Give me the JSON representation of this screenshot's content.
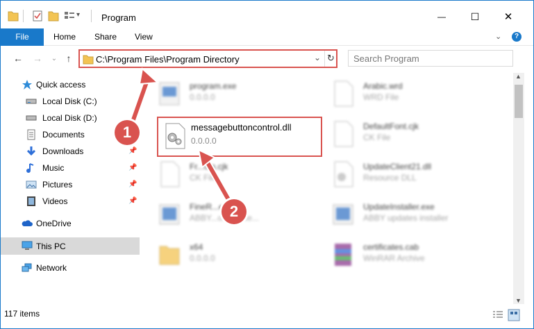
{
  "window": {
    "title": "Program",
    "minimize": "—",
    "maximize": "☐",
    "close": "✕"
  },
  "ribbon": {
    "tabs": [
      "File",
      "Home",
      "Share",
      "View"
    ],
    "expand_icon": "chevron-down",
    "help_icon": "help"
  },
  "address": {
    "path": "C:\\Program Files\\Program Directory",
    "refresh_icon": "refresh",
    "dropdown_icon": "chevron-down"
  },
  "search": {
    "placeholder": "Search Program"
  },
  "sidebar": {
    "items": [
      {
        "label": "Quick access",
        "icon": "star-icon",
        "pinned": false
      },
      {
        "label": "Local Disk (C:)",
        "icon": "drive-icon",
        "pinned": false
      },
      {
        "label": "Local Disk (D:)",
        "icon": "drive-icon",
        "pinned": false
      },
      {
        "label": "Documents",
        "icon": "documents-icon",
        "pinned": true
      },
      {
        "label": "Downloads",
        "icon": "download-icon",
        "pinned": true
      },
      {
        "label": "Music",
        "icon": "music-icon",
        "pinned": true
      },
      {
        "label": "Pictures",
        "icon": "pictures-icon",
        "pinned": true
      },
      {
        "label": "Videos",
        "icon": "videos-icon",
        "pinned": true
      },
      {
        "label": "OneDrive",
        "icon": "cloud-icon",
        "pinned": false
      },
      {
        "label": "This PC",
        "icon": "computer-icon",
        "pinned": false,
        "selected": true
      },
      {
        "label": "Network",
        "icon": "network-icon",
        "pinned": false
      }
    ]
  },
  "files": [
    {
      "name": "program.exe",
      "type": "0.0.0.0",
      "blurred": true
    },
    {
      "name": "Arabic.wrd",
      "type": "WRD File",
      "blurred": true
    },
    {
      "name": "messagebuttoncontrol.dll",
      "type": "0.0.0.0",
      "blurred": false,
      "highlighted": true
    },
    {
      "name": "DefaultFont.cjk",
      "type": "CK File",
      "blurred": true
    },
    {
      "name": "Fr...om.cjk",
      "type": "CK File",
      "blurred": true
    },
    {
      "name": "UpdateClient21.dll",
      "type": "Resource DLL",
      "blurred": true
    },
    {
      "name": "FineR...e",
      "type": "ABBY...ound exe...",
      "blurred": true
    },
    {
      "name": "UpdateInstaller.exe",
      "type": "ABBY updates installer",
      "blurred": true
    },
    {
      "name": "x64",
      "type": "0.0.0.0",
      "blurred": true
    },
    {
      "name": "certificates.cab",
      "type": "WinRAR Archive",
      "blurred": true
    }
  ],
  "status": {
    "item_count": "117 items"
  },
  "annotations": {
    "step1": "1",
    "step2": "2",
    "color": "#d9534f"
  },
  "colors": {
    "accent": "#1979ca",
    "highlight": "#d9534f",
    "selected_bg": "#d9d9d9"
  }
}
